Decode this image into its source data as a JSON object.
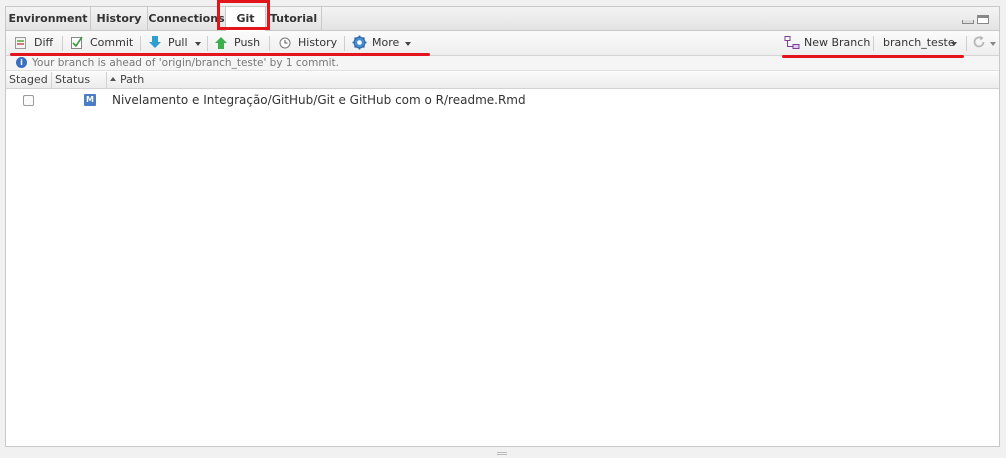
{
  "tabs": [
    {
      "label": "Environment"
    },
    {
      "label": "History"
    },
    {
      "label": "Connections"
    },
    {
      "label": "Git"
    },
    {
      "label": "Tutorial"
    }
  ],
  "toolbar": {
    "diff": "Diff",
    "commit": "Commit",
    "pull": "Pull",
    "push": "Push",
    "history": "History",
    "more": "More",
    "new_branch": "New Branch",
    "branch": "branch_teste"
  },
  "info_message": "Your branch is ahead of 'origin/branch_teste' by 1 commit.",
  "table": {
    "headers": {
      "staged": "Staged",
      "status": "Status",
      "path": "Path"
    },
    "rows": [
      {
        "status": "M",
        "path": "Nivelamento e Integração/GitHub/Git e GitHub com o R/readme.Rmd"
      }
    ]
  },
  "colors": {
    "annotation": "#e3141b",
    "modified_badge": "#4a7ec4"
  }
}
